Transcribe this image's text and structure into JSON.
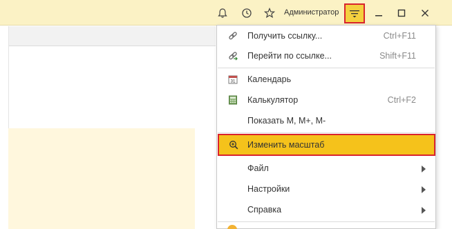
{
  "titlebar": {
    "user_name": "Администратор",
    "icons": [
      "bell-icon",
      "history-icon",
      "star-icon",
      "menu-icon",
      "minimize-icon",
      "maximize-icon",
      "close-icon"
    ]
  },
  "menu": {
    "items": [
      {
        "label": "Получить ссылку...",
        "shortcut": "Ctrl+F11",
        "icon": "link-icon"
      },
      {
        "label": "Перейти по ссылке...",
        "shortcut": "Shift+F11",
        "icon": "goto-link-icon"
      },
      {
        "label": "Календарь",
        "shortcut": "",
        "icon": "calendar-icon"
      },
      {
        "label": "Калькулятор",
        "shortcut": "Ctrl+F2",
        "icon": "calculator-icon"
      },
      {
        "label": "Показать M, M+, M-",
        "shortcut": "",
        "icon": ""
      },
      {
        "label": "Изменить масштаб",
        "shortcut": "",
        "icon": "zoom-icon"
      },
      {
        "label": "Файл",
        "shortcut": "",
        "icon": ""
      },
      {
        "label": "Настройки",
        "shortcut": "",
        "icon": ""
      },
      {
        "label": "Справка",
        "shortcut": "",
        "icon": ""
      }
    ]
  },
  "colors": {
    "titlebar_bg": "#fbf2c5",
    "highlight": "#f5c21b",
    "outline": "#d9232d"
  }
}
